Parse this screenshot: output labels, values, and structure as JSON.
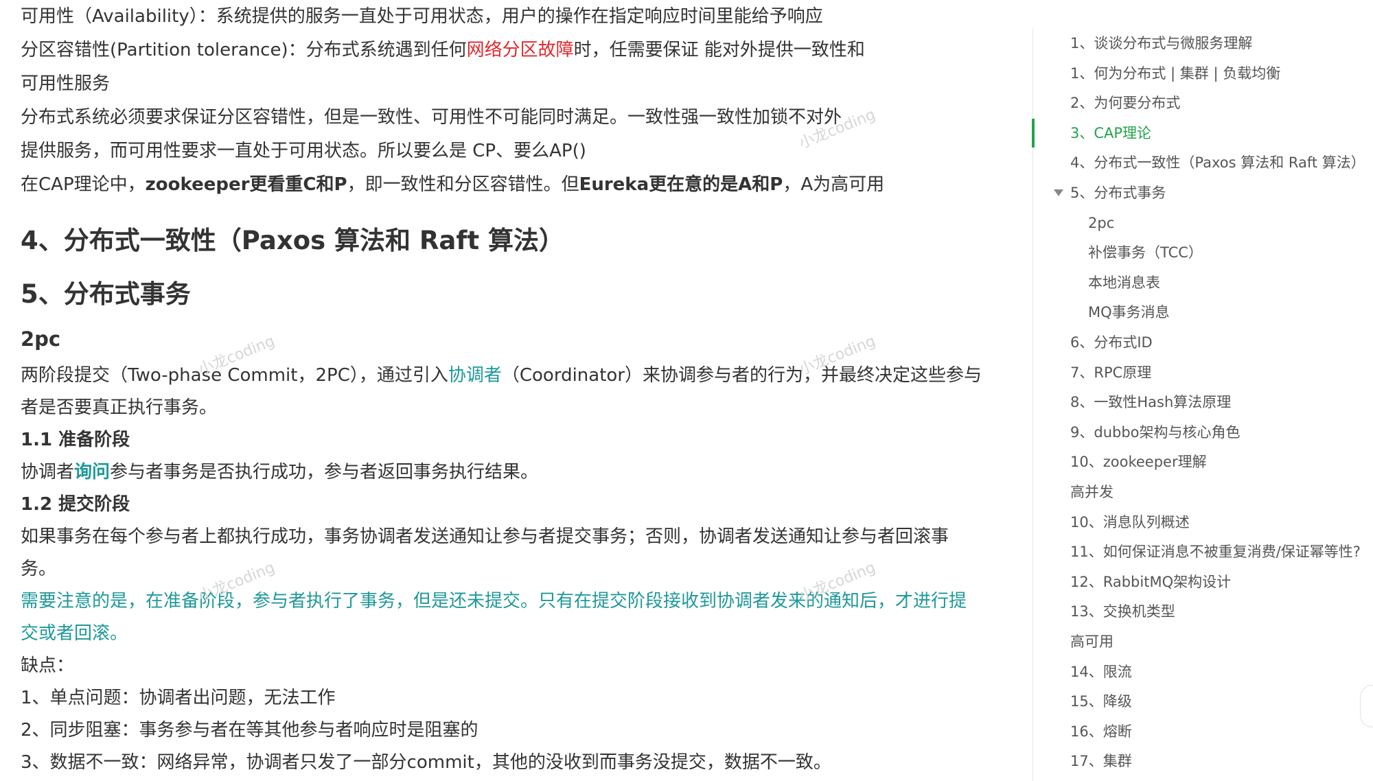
{
  "article": {
    "line1": "可用性（Availability）：系统提供的服务一直处于可用状态，用户的操作在指定响应时间里能给予响应",
    "line2_a": "分区容错性(Partition tolerance)：分布式系统遇到任何",
    "line2_red": "网络分区故障",
    "line2_b": "时，任需要保证 能对外提供一致性和",
    "line3": "可用性服务",
    "line4": "分布式系统必须要求保证分区容错性，但是一致性、可用性不可能同时满足。一致性强一致性加锁不对外",
    "line5": "提供服务，而可用性要求一直处于可用状态。所以要么是 CP、要么AP()",
    "line6_a": "在CAP理论中，",
    "line6_b1": "zookeeper更看重C和P",
    "line6_c": "，即一致性和分区容错性。但",
    "line6_b2": "Eureka更在意的是A和P",
    "line6_d": "，A为高可用",
    "h2_consistency": "4、分布式一致性（Paxos 算法和 Raft 算法）",
    "h2_transaction": "5、分布式事务",
    "h3_2pc": "2pc",
    "p2pc_a": "两阶段提交（Two-phase Commit，2PC），通过引入",
    "p2pc_link": "协调者",
    "p2pc_b": "（Coordinator）来协调参与者的行为，并最终决定这些参与",
    "p2pc_c": "者是否要真正执行事务。",
    "h4_prepare": "1.1 准备阶段",
    "prepare_a": "协调者",
    "prepare_bold": "询问",
    "prepare_b": "参与者事务是否执行成功，参与者返回事务执行结果。",
    "h4_commit": "1.2 提交阶段",
    "commit_a": "如果事务在每个参与者上都执行成功，事务协调者发送通知让参与者提交事务；否则，协调者发送通知让参与者回滚事",
    "commit_b": "务。",
    "note_a": "需要注意的是，在准备阶段，参与者执行了事务，但是还未提交。只有在提交阶段接收到协调者发来的通知后，才进行提",
    "note_b": "交或者回滚。",
    "cons_title": "缺点：",
    "cons1": "1、单点问题：协调者出问题，无法工作",
    "cons2": "2、同步阻塞：事务参与者在等其他参与者响应时是阻塞的",
    "cons3": "3、数据不一致：网络异常，协调者只发了一部分commit，其他的没收到而事务没提交，数据不一致。",
    "watermark": "小龙coding"
  },
  "outline": {
    "items": [
      "1、谈谈分布式与微服务理解",
      "1、何为分布式 | 集群 | 负载均衡",
      "2、为何要分布式",
      "3、CAP理论",
      "4、分布式一致性（Paxos 算法和 Raft 算法）",
      "5、分布式事务",
      "2pc",
      "补偿事务（TCC）",
      "本地消息表",
      "MQ事务消息",
      "6、分布式ID",
      "7、RPC原理",
      "8、一致性Hash算法原理",
      "9、dubbo架构与核心角色",
      "10、zookeeper理解",
      "高并发",
      "10、消息队列概述",
      "11、如何保证消息不被重复消费/保证幂等性?",
      "12、RabbitMQ架构设计",
      "13、交换机类型",
      "高可用",
      "14、限流",
      "15、降级",
      "16、熔断",
      "17、集群"
    ],
    "active_index": 3,
    "expanded_index": 5
  },
  "colors": {
    "accent_green": "#22a34a",
    "link_teal": "#1e9898",
    "highlight_red": "#e0272c",
    "text": "#333333"
  }
}
